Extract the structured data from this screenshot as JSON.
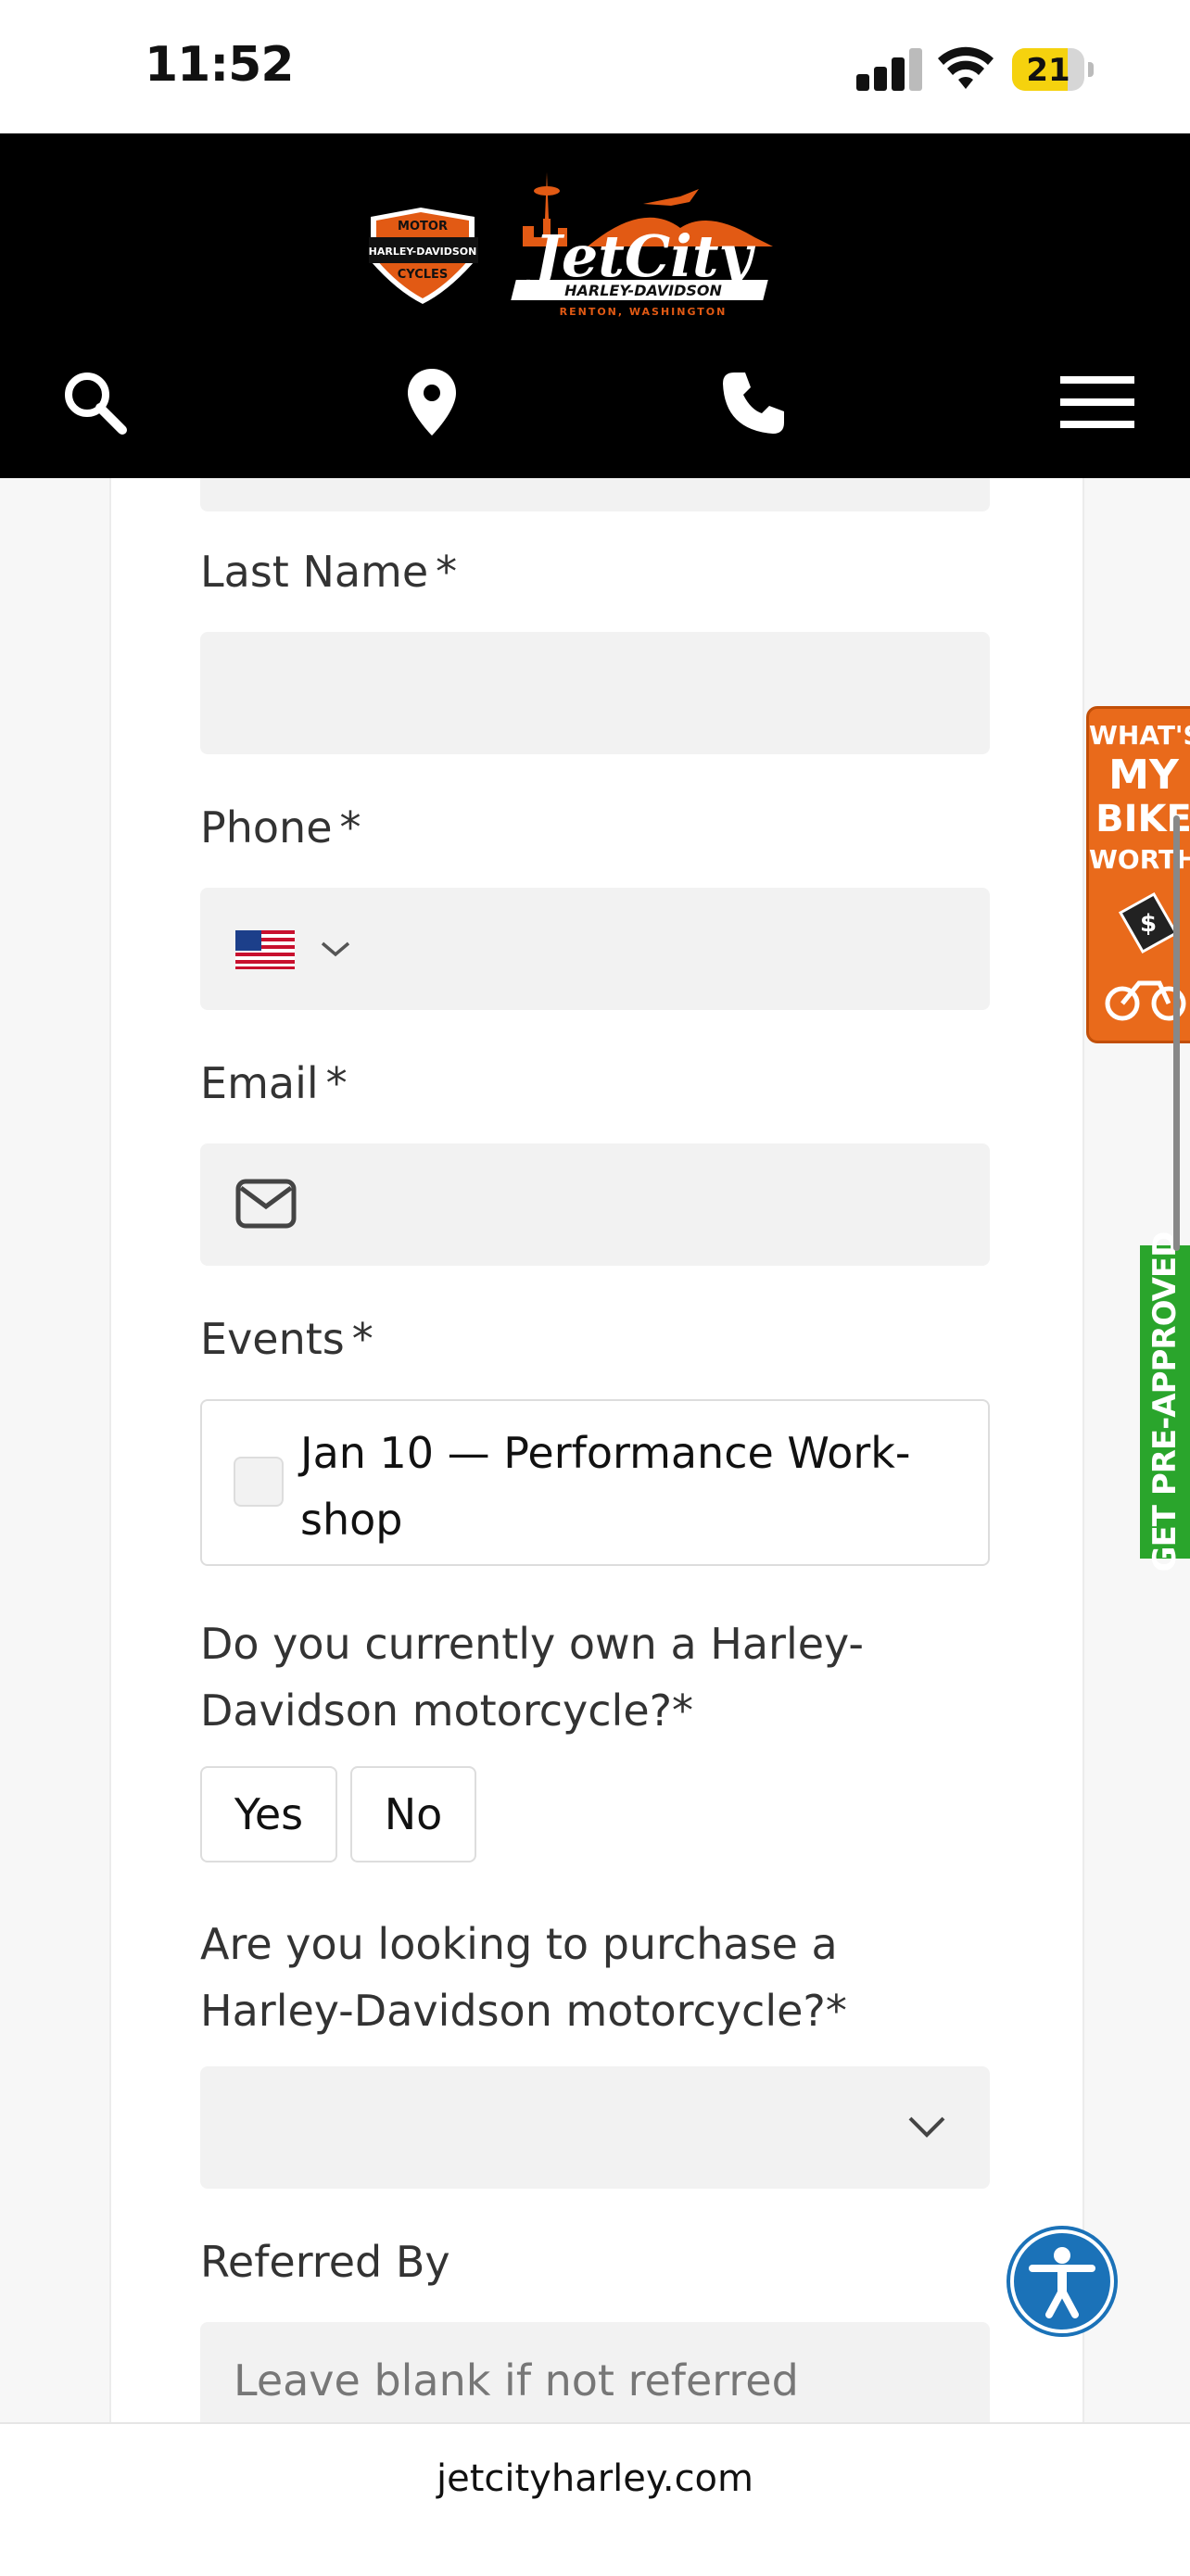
{
  "status_bar": {
    "time": "11:52",
    "battery_level": "21",
    "battery_fraction": 0.21,
    "battery_color": "#f5d20e"
  },
  "header": {
    "logo": {
      "badge_top": "MOTOR",
      "badge_middle": "HARLEY-DAVIDSON",
      "badge_bottom": "CYCLES",
      "wordmark": "JetCity",
      "subline": "HARLEY-DAVIDSON",
      "location": "RENTON, WASHINGTON"
    },
    "icons": [
      "search-icon",
      "location-pin-icon",
      "phone-icon",
      "menu-icon"
    ]
  },
  "form": {
    "last_name": {
      "label": "Last Name",
      "required_mark": "*"
    },
    "phone": {
      "label": "Phone",
      "required_mark": "*",
      "country_flag": "us-flag-icon"
    },
    "email": {
      "label": "Email",
      "required_mark": "*",
      "icon": "envelope-icon"
    },
    "events": {
      "label": "Events",
      "required_mark": "*",
      "option_line1": "Jan 10 — Performance Work-",
      "option_line2": "shop"
    },
    "own_question": {
      "line1": "Do you currently own a Harley-",
      "line2": "Davidson motorcycle?",
      "required_mark": "*",
      "yes_label": "Yes",
      "no_label": "No"
    },
    "purchase_question": {
      "line1": "Are you looking to purchase a",
      "line2": "Harley-Davidson motorcycle?",
      "required_mark": "*"
    },
    "referred_by": {
      "label": "Referred By",
      "placeholder": "Leave blank if not referred"
    }
  },
  "side_tabs": {
    "bike_worth": {
      "line1": "WHAT'S",
      "line2": "MY",
      "line3": "BIKE",
      "line4": "WORTH?",
      "color": "#e96a1b"
    },
    "pre_approved": {
      "label": "GET PRE-APPROVED",
      "color": "#2aa52c"
    }
  },
  "accessibility_button": {
    "icon": "accessibility-icon",
    "color": "#1b72b8"
  },
  "browser": {
    "url": "jetcityharley.com"
  }
}
